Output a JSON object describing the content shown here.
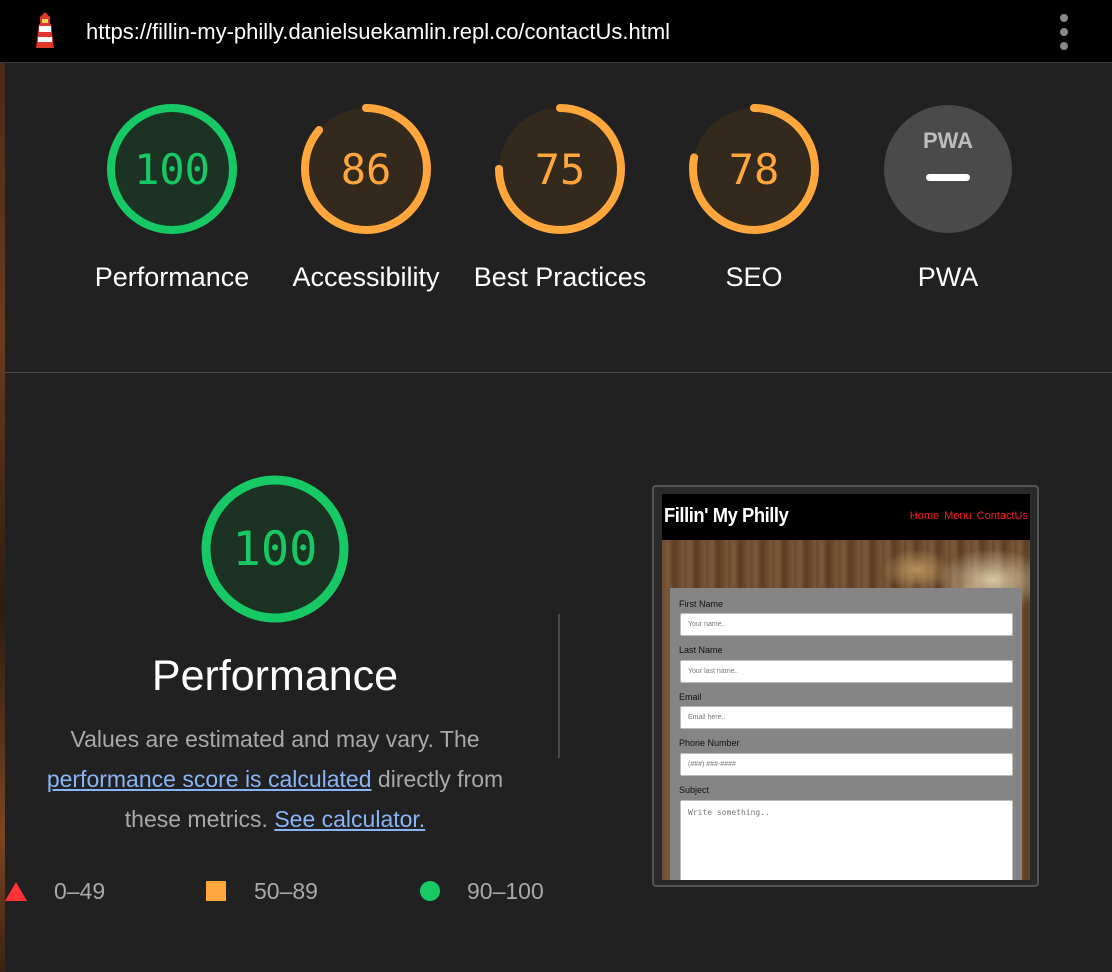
{
  "topbar": {
    "url": "https://fillin-my-philly.danielsuekamlin.repl.co/contactUs.html"
  },
  "colors": {
    "pass": "#17c964",
    "average": "#ffa63d",
    "fail": "#ff3333",
    "pwa_gray": "#4a4a4a",
    "link": "#8ab4f8"
  },
  "gauges": [
    {
      "score": "100",
      "label": "Performance",
      "status": "pass"
    },
    {
      "score": "86",
      "label": "Accessibility",
      "status": "average"
    },
    {
      "score": "75",
      "label": "Best Practices",
      "status": "average"
    },
    {
      "score": "78",
      "label": "SEO",
      "status": "average"
    },
    {
      "score": "",
      "label": "PWA",
      "status": "na",
      "badge": "PWA",
      "badge_mark": "—"
    }
  ],
  "performance": {
    "score": "100",
    "title": "Performance",
    "desc_pre": "Values are estimated and may vary. The",
    "desc_link": "performance score is calculated",
    "desc_mid": "directly from these metrics.",
    "desc_link2": "See calculator."
  },
  "legend": {
    "fail": "0–49",
    "average": "50–89",
    "pass": "90–100"
  },
  "thumbnail": {
    "site_title": "Fillin' My Philly",
    "nav": [
      "Home",
      "Menu",
      "ContactUs"
    ],
    "fields": [
      {
        "label": "First Name",
        "placeholder": "Your name.."
      },
      {
        "label": "Last Name",
        "placeholder": "Your last name.."
      },
      {
        "label": "Email",
        "placeholder": "Email here.."
      },
      {
        "label": "Phone Number",
        "placeholder": "(###) ###-####"
      }
    ],
    "subject_label": "Subject",
    "subject_placeholder": "Write something.."
  }
}
